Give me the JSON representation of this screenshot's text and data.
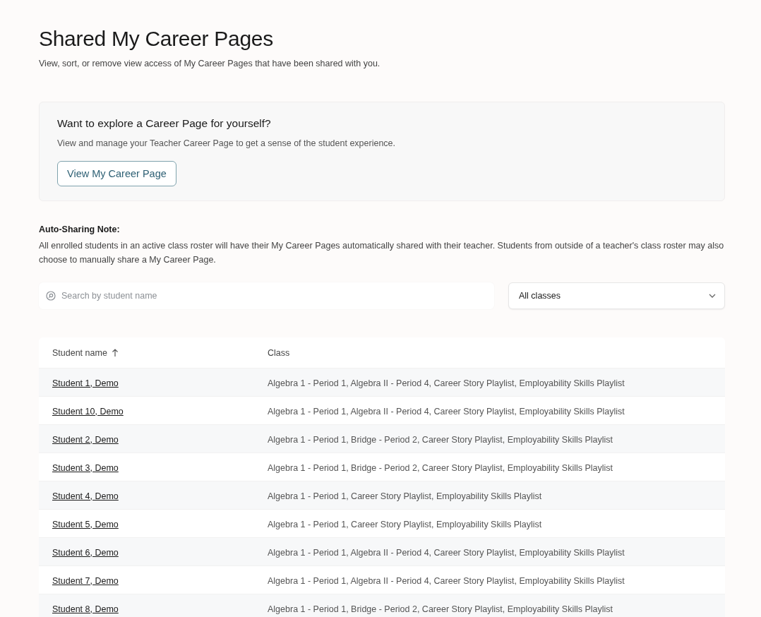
{
  "page": {
    "title": "Shared My Career Pages",
    "subtitle": "View, sort, or remove view access of My Career Pages that have been shared with you."
  },
  "promo": {
    "title": "Want to explore a Career Page for yourself?",
    "text": "View and manage your Teacher Career Page to get a sense of the student experience.",
    "button": "View My Career Page"
  },
  "note": {
    "title": "Auto-Sharing Note:",
    "text": "All enrolled students in an active class roster will have their My Career Pages automatically shared with their teacher. Students from outside of a teacher's class roster may also choose to manually share a My Career Page."
  },
  "search": {
    "placeholder": "Search by student name"
  },
  "class_filter": {
    "value": "All classes"
  },
  "table": {
    "columns": [
      {
        "label": "Student name",
        "sorted": true
      },
      {
        "label": "Class",
        "sorted": false
      }
    ],
    "rows": [
      {
        "student": "Student 1, Demo",
        "class": "Algebra 1 - Period 1, Algebra II - Period 4, Career Story Playlist, Employability Skills Playlist"
      },
      {
        "student": "Student 10, Demo",
        "class": "Algebra 1 - Period 1, Algebra II - Period 4, Career Story Playlist, Employability Skills Playlist"
      },
      {
        "student": "Student 2, Demo",
        "class": "Algebra 1 - Period 1, Bridge - Period 2, Career Story Playlist, Employability Skills Playlist"
      },
      {
        "student": "Student 3, Demo",
        "class": "Algebra 1 - Period 1, Bridge - Period 2, Career Story Playlist, Employability Skills Playlist"
      },
      {
        "student": "Student 4, Demo",
        "class": "Algebra 1 - Period 1, Career Story Playlist, Employability Skills Playlist"
      },
      {
        "student": "Student 5, Demo",
        "class": "Algebra 1 - Period 1, Career Story Playlist, Employability Skills Playlist"
      },
      {
        "student": "Student 6, Demo",
        "class": "Algebra 1 - Period 1, Algebra II - Period 4, Career Story Playlist, Employability Skills Playlist"
      },
      {
        "student": "Student 7, Demo",
        "class": "Algebra 1 - Period 1, Algebra II - Period 4, Career Story Playlist, Employability Skills Playlist"
      },
      {
        "student": "Student 8, Demo",
        "class": "Algebra 1 - Period 1, Bridge - Period 2, Career Story Playlist, Employability Skills Playlist"
      }
    ]
  }
}
